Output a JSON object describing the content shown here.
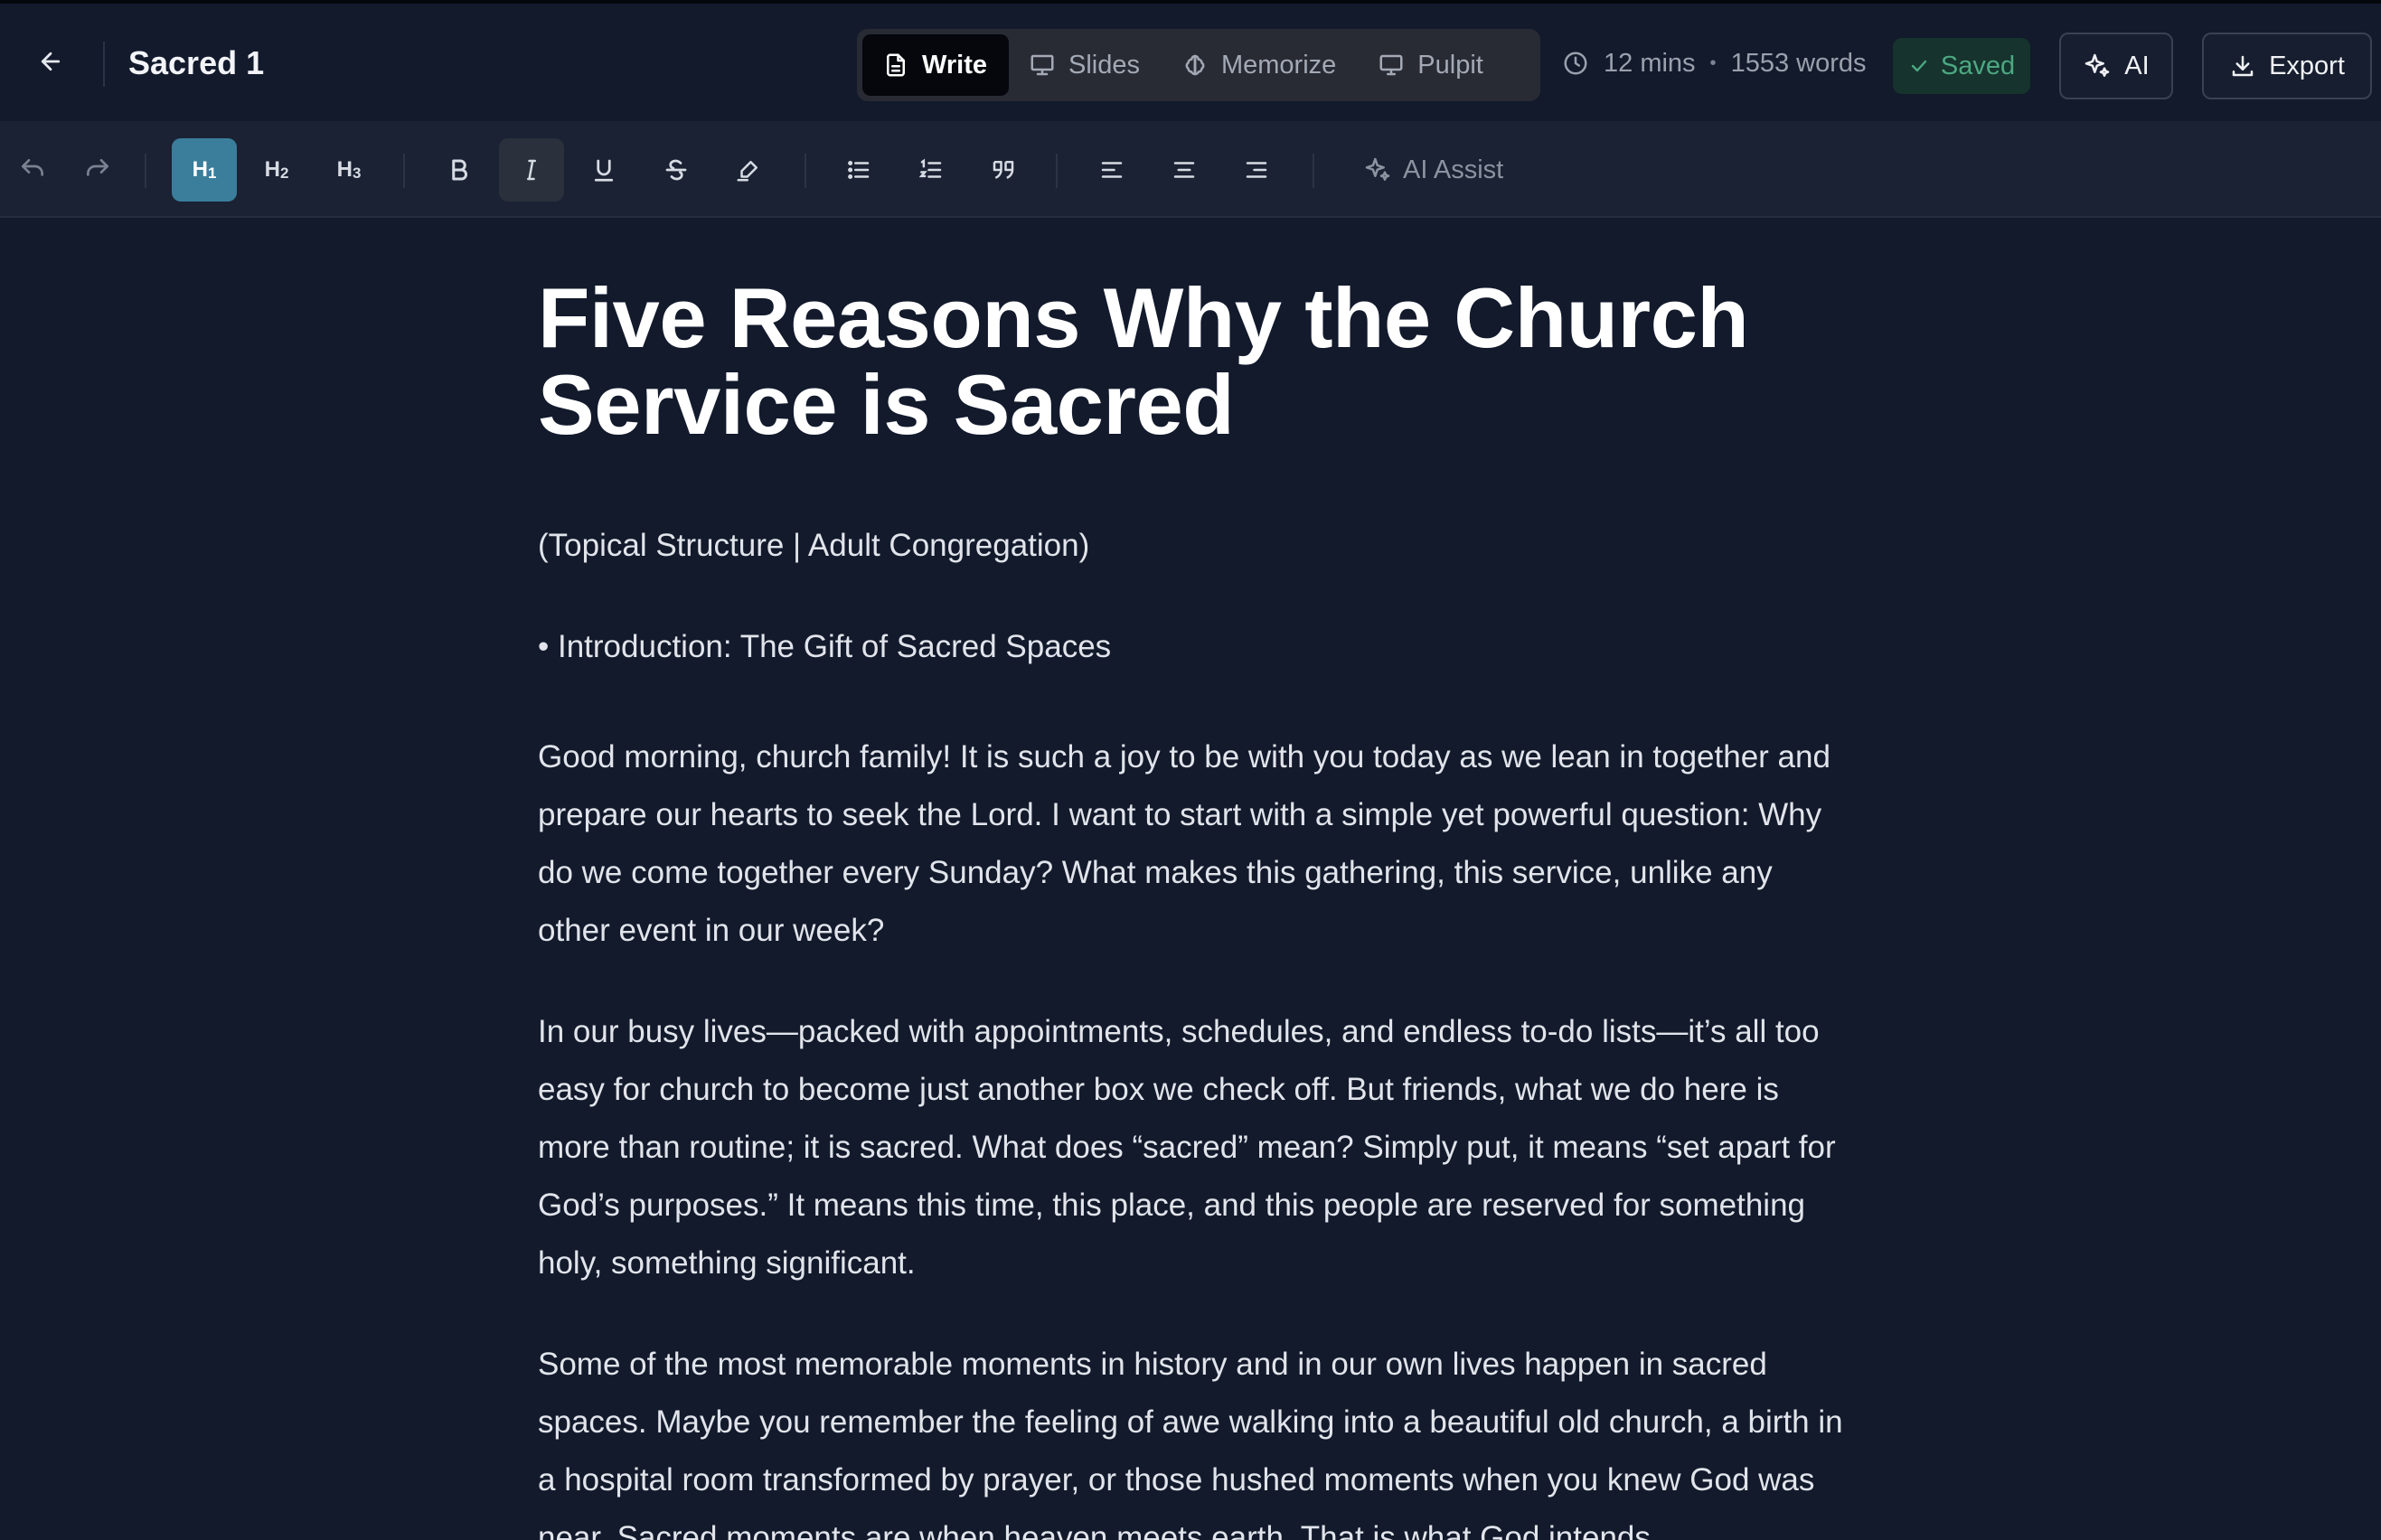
{
  "header": {
    "doc_title": "Sacred 1",
    "modes": {
      "write": "Write",
      "slides": "Slides",
      "memorize": "Memorize",
      "pulpit": "Pulpit"
    },
    "stats": {
      "read_time": "12 mins",
      "separator": "•",
      "word_count": "1553 words"
    },
    "saved_label": "Saved",
    "ai_label": "AI",
    "export_label": "Export"
  },
  "toolbar": {
    "h1": "H",
    "h1_sub": "1",
    "h2": "H",
    "h2_sub": "2",
    "h3": "H",
    "h3_sub": "3",
    "ai_assist": "AI Assist"
  },
  "document": {
    "title": "Five Reasons Why the Church Service is Sacred",
    "subtitle": "(Topical Structure | Adult Congregation)",
    "bullet": "• Introduction: The Gift of Sacred Spaces",
    "paragraphs": [
      "Good morning, church family! It is such a joy to be with you today as we lean in together and prepare our hearts to seek the Lord. I want to start with a simple yet powerful question: Why do we come together every Sunday? What makes this gathering, this service, unlike any other event in our week?",
      "In our busy lives—packed with appointments, schedules, and endless to-do lists—it’s all too easy for church to become just another box we check off. But friends, what we do here is more than routine; it is sacred. What does “sacred” mean? Simply put, it means “set apart for God’s purposes.” It means this time, this place, and this people are reserved for something holy, something significant.",
      "Some of the most memorable moments in history and in our own lives happen in sacred spaces. Maybe you remember the feeling of awe walking into a beautiful old church, a birth in a hospital room transformed by prayer, or those hushed moments when you knew God was near. Sacred moments are when heaven meets earth. That is what God intends"
    ]
  },
  "colors": {
    "background": "#121a2c",
    "toolbar": "#1a2233",
    "accent_h1": "#3a7e9b",
    "saved_green": "#4ca882",
    "mode_active": "#05070c"
  }
}
